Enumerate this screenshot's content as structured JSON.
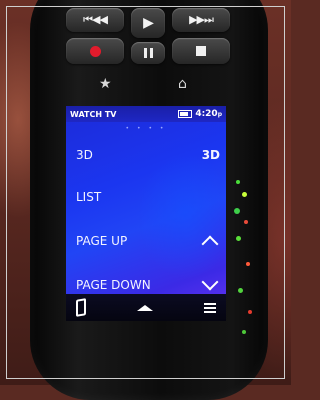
{
  "remote": {
    "transport_buttons": [
      {
        "name": "rewind-button",
        "icon": "skip-rewind-icon",
        "glyph": "⏮◀◀"
      },
      {
        "name": "play-button",
        "icon": "play-icon",
        "glyph": "▶"
      },
      {
        "name": "fast-forward-button",
        "icon": "fast-forward-skip-icon",
        "glyph": "▶▶⏭"
      },
      {
        "name": "record-button",
        "icon": "record-icon",
        "glyph": ""
      },
      {
        "name": "pause-button",
        "icon": "pause-icon",
        "glyph": ""
      },
      {
        "name": "stop-button",
        "icon": "stop-icon",
        "glyph": ""
      }
    ],
    "star_glyph": "★",
    "home_glyph": "⌂",
    "record_color": "#e21b2c"
  },
  "screen": {
    "title": "WATCH TV",
    "time": "4:20",
    "time_suffix": "p",
    "page_dots": "• • • •",
    "rows": [
      {
        "label": "3D",
        "right": "3D"
      },
      {
        "label": "LIST",
        "right": ""
      },
      {
        "label": "PAGE UP",
        "right": "chevron-up-icon"
      },
      {
        "label": "PAGE DOWN",
        "right": "chevron-down-icon"
      }
    ],
    "bottom_icons": [
      "phone-icon",
      "expand-up-icon",
      "menu-icon"
    ],
    "colors": {
      "screen_blue": "#1b36f0",
      "glow_purple": "#6a34f2"
    }
  }
}
